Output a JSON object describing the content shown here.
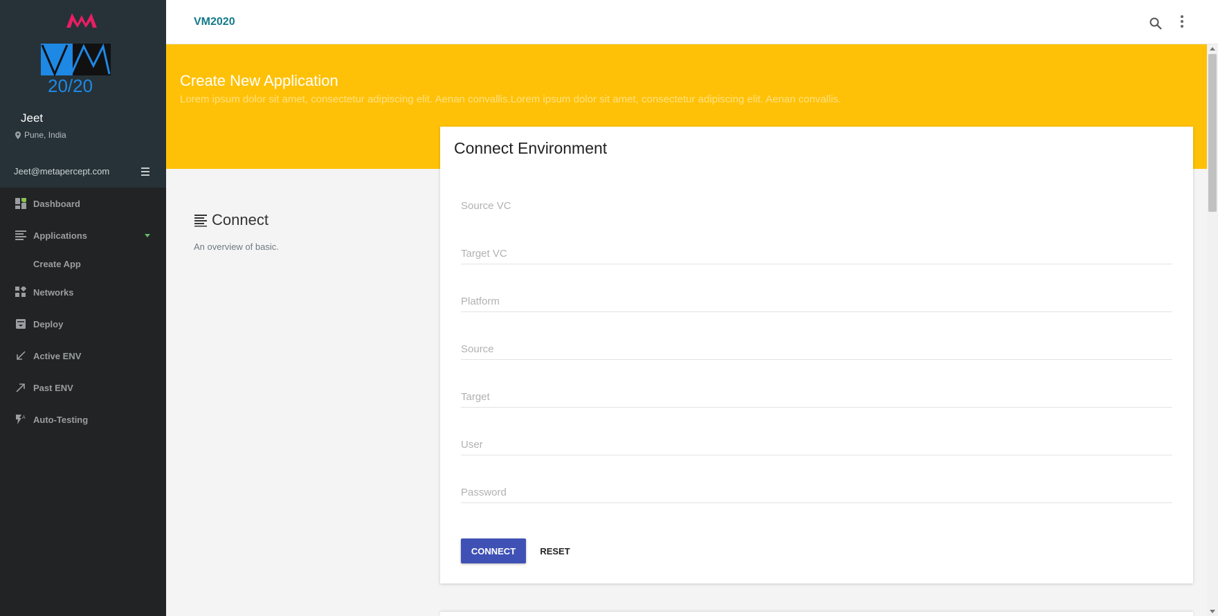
{
  "header": {
    "app_title": "VM2020"
  },
  "logo": {
    "text": "20/20"
  },
  "user": {
    "name": "Jeet",
    "location": "Pune, India",
    "email": "Jeet@metapercept.com"
  },
  "sidebar": {
    "items": [
      {
        "label": "Dashboard",
        "icon": "dashboard-icon"
      },
      {
        "label": "Applications",
        "icon": "list-icon"
      },
      {
        "label": "Create App"
      },
      {
        "label": "Networks",
        "icon": "widgets-icon"
      },
      {
        "label": "Deploy",
        "icon": "archive-icon"
      },
      {
        "label": "Active ENV",
        "icon": "arrow-down-left-icon"
      },
      {
        "label": "Past ENV",
        "icon": "arrow-up-right-icon"
      },
      {
        "label": "Auto-Testing",
        "icon": "flash-auto-icon"
      }
    ]
  },
  "banner": {
    "title": "Create New Application",
    "subtitle": "Lorem ipsum dolor sit amet, consectetur adipiscing elit. Aenan convallis.Lorem ipsum dolor sit amet, consectetur adipiscing elit. Aenan convallis."
  },
  "section": {
    "title": "Connect",
    "subtitle": "An overview of basic."
  },
  "card": {
    "title": "Connect Environment",
    "fields": [
      {
        "label": "Source VC"
      },
      {
        "label": "Target VC"
      },
      {
        "label": "Platform"
      },
      {
        "label": "Source"
      },
      {
        "label": "Target"
      },
      {
        "label": "User"
      },
      {
        "label": "Password"
      }
    ],
    "connect_label": "CONNECT",
    "reset_label": "RESET"
  },
  "colors": {
    "sidebar_bg": "#212324",
    "sidebar_top_bg": "#263238",
    "banner": "#ffc107",
    "primary_button": "#3f51b5",
    "app_title": "#127a8a",
    "brand_pink": "#e91e63",
    "logo_blue": "#1e88e5"
  }
}
